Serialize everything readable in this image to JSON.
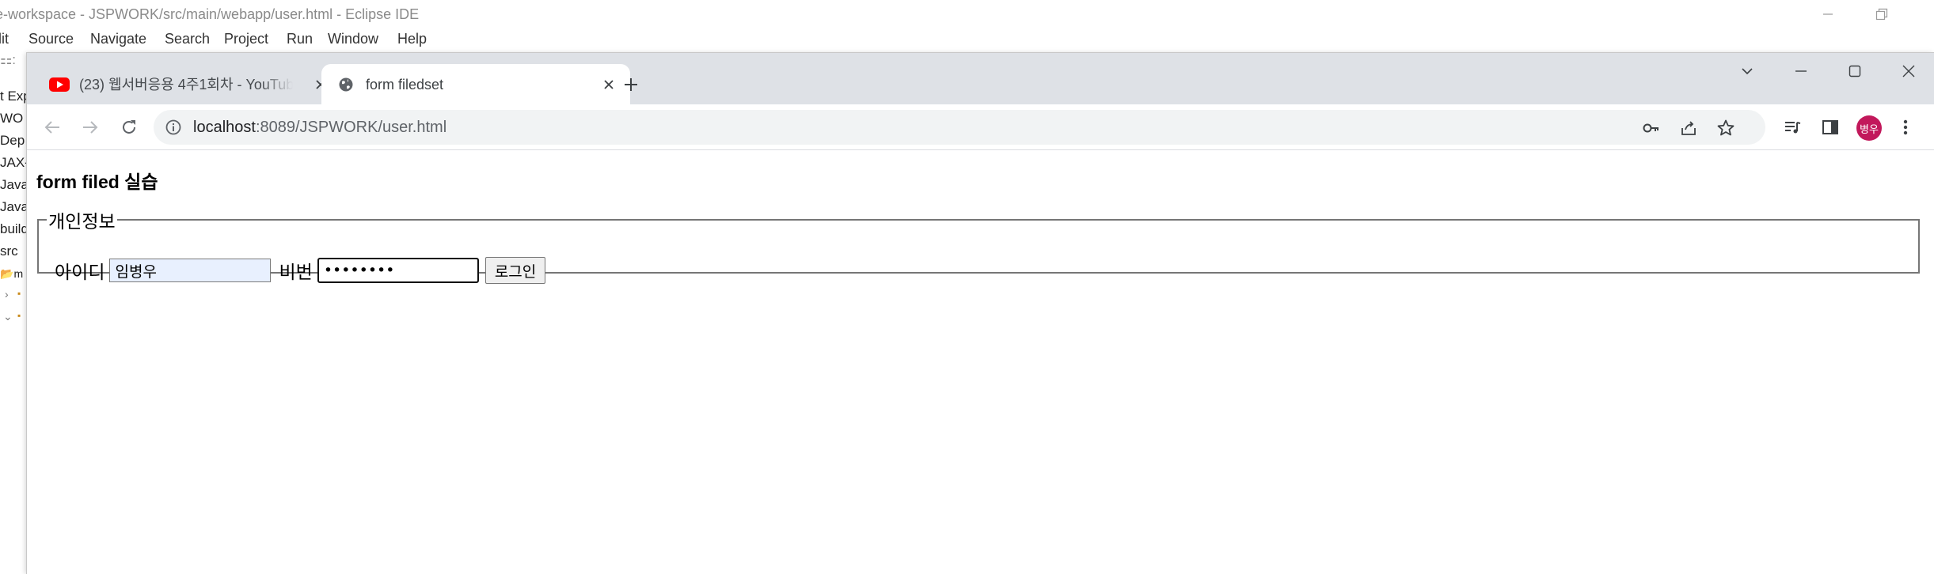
{
  "eclipse": {
    "title": "e-workspace - JSPWORK/src/main/webapp/user.html - Eclipse IDE",
    "menu": {
      "edit_fragment": "lit",
      "source": "Source",
      "navigate": "Navigate",
      "search": "Search",
      "project": "Project",
      "run": "Run",
      "window": "Window",
      "help": "Help"
    },
    "sidebar": [
      "t Exp",
      "WO",
      "Dep",
      "JAX-",
      "Java",
      "Java",
      "build",
      "src",
      "m"
    ]
  },
  "browser": {
    "tabs": [
      {
        "title": "(23) 웹서버응용 4주1회차 - YouTube",
        "favicon": "youtube-icon",
        "active": false
      },
      {
        "title": "form filedset",
        "favicon": "globe-icon",
        "active": true
      }
    ],
    "url_host": "localhost",
    "url_path": ":8089/JSPWORK/user.html",
    "profile_initials": "병우",
    "colors": {
      "profile": "#c2185b",
      "tabstrip": "#dee1e6",
      "youtube": "#ff0000"
    }
  },
  "page": {
    "heading": "form filed 실습",
    "fieldset_legend": "개인정보",
    "id_label": "아이디",
    "id_value": "임병우",
    "pw_label": "비번",
    "pw_value": "12345678",
    "login_button": "로그인"
  }
}
